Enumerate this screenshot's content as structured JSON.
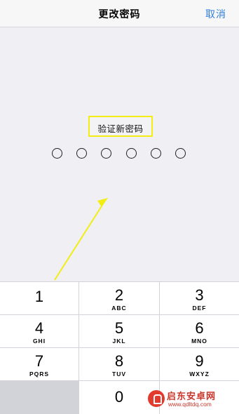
{
  "nav": {
    "title": "更改密码",
    "cancel_label": "取消"
  },
  "prompt": {
    "label": "验证新密码"
  },
  "passcode": {
    "length": 6,
    "entered": 0
  },
  "keypad": {
    "keys": [
      {
        "number": "1",
        "letters": ""
      },
      {
        "number": "2",
        "letters": "ABC"
      },
      {
        "number": "3",
        "letters": "DEF"
      },
      {
        "number": "4",
        "letters": "GHI"
      },
      {
        "number": "5",
        "letters": "JKL"
      },
      {
        "number": "6",
        "letters": "MNO"
      },
      {
        "number": "7",
        "letters": "PQRS"
      },
      {
        "number": "8",
        "letters": "TUV"
      },
      {
        "number": "9",
        "letters": "WXYZ"
      },
      {
        "number": "0",
        "letters": ""
      }
    ]
  },
  "watermark": {
    "name": "启东安卓网",
    "url": "www.qdltdq.com"
  },
  "colors": {
    "accent": "#2f7ed8",
    "highlight": "#f2ee13",
    "arrow": "#f2ee13"
  }
}
